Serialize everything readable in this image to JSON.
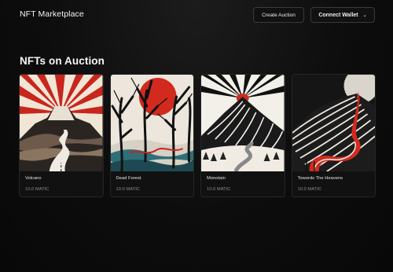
{
  "header": {
    "brand": "NFT Marketplace",
    "create_label": "Create Auction",
    "wallet_label": "Connect Wallet",
    "wallet_chevron": "⌄"
  },
  "main": {
    "section_title": "NFTs on Auction",
    "nfts": [
      {
        "name": "Volcano",
        "price": "10.0 MATIC"
      },
      {
        "name": "Dead Forest",
        "price": "10.0 MATIC"
      },
      {
        "name": "Monotain",
        "price": "10.0 MATIC"
      },
      {
        "name": "Towords The Heavens",
        "price": "10.0 MATIC"
      }
    ]
  },
  "colors": {
    "background": "#0b0b0b",
    "accent_red": "#d22a1e",
    "card_bg": "#111111"
  }
}
